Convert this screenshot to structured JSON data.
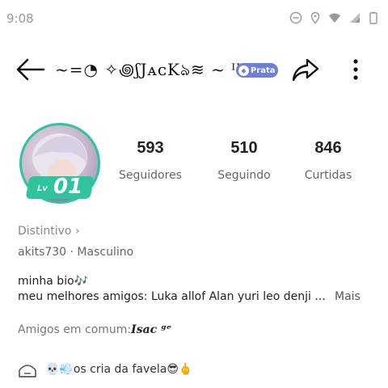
{
  "status_bar": {
    "time": "9:08"
  },
  "header": {
    "title": "~=◔ ✧꩜ʃJᴀᴄKঌ≋ ~ ᴵᴵ",
    "badge": "Prata"
  },
  "profile": {
    "level_prefix": "Lv",
    "level": "01",
    "stats": [
      {
        "value": "593",
        "label": "Seguidores"
      },
      {
        "value": "510",
        "label": "Seguindo"
      },
      {
        "value": "846",
        "label": "Curtidas"
      }
    ],
    "badge_link": "Distintivo ›",
    "username_gender": "akits730 · Masculino",
    "bio_title": "minha bio🎶",
    "bio_text": "meu melhores amigos: Luka allof Alan yuri leo denji ...",
    "bio_more": "Mais",
    "friends_label": "Amigos em comum:",
    "friends_name": "Isac ᵍᵉ",
    "community": "💀💨os cria da favela😎🖕"
  },
  "colors": {
    "accent": "#2fc39e",
    "badge": "#6c7fd9"
  }
}
